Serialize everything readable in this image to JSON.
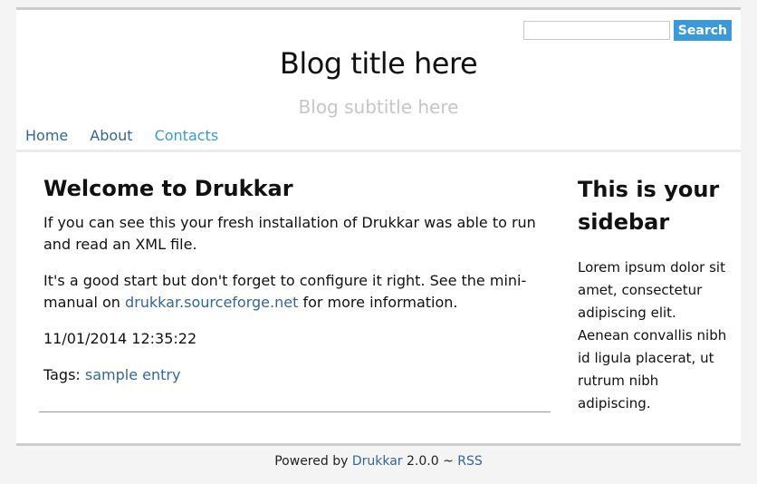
{
  "search": {
    "placeholder": "",
    "value": "",
    "button_label": "Search"
  },
  "header": {
    "title": "Blog title here",
    "subtitle": "Blog subtitle here"
  },
  "nav": {
    "items": [
      {
        "label": "Home"
      },
      {
        "label": "About"
      },
      {
        "label": "Contacts",
        "active": true
      }
    ]
  },
  "post": {
    "title": "Welcome to Drukkar",
    "paragraph1": "If you can see this your fresh installation of Drukkar was able to run and read an XML file.",
    "paragraph2_before": "It's a good start but don't forget to configure it right. See the mini-manual on ",
    "paragraph2_link": "drukkar.sourceforge.net",
    "paragraph2_after": " for more information.",
    "date": "11/01/2014 12:35:22",
    "tags_label": "Tags: ",
    "tags": [
      "sample entry"
    ]
  },
  "sidebar": {
    "title": "This is your sidebar",
    "text": "Lorem ipsum dolor sit amet, consectetur adipiscing elit. Aenean convallis nibh id ligula placerat, ut rutrum nibh adipiscing."
  },
  "footer": {
    "powered_by": "Powered by ",
    "link": "Drukkar",
    "version": " 2.0.0 ~ ",
    "rss": "RSS"
  },
  "colors": {
    "accent": "#3a9ad9",
    "link": "#336699",
    "subtitle": "#c6c6c6",
    "background": "#f4f4f4"
  }
}
